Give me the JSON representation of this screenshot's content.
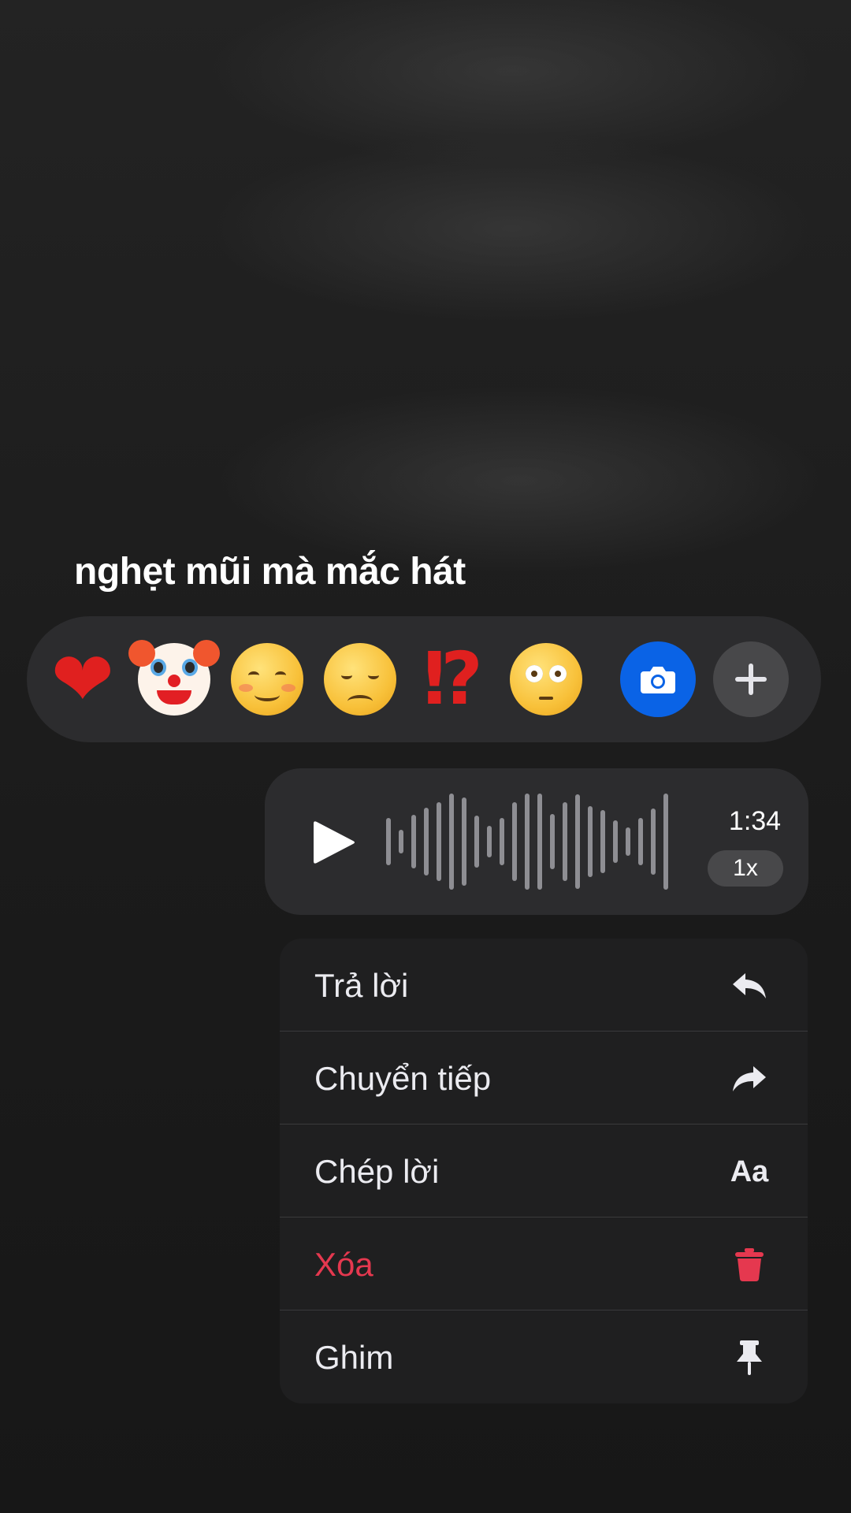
{
  "message": {
    "caption": "nghẹt mũi mà mắc hát"
  },
  "reactions": [
    {
      "name": "heart-emoji",
      "glyph": "❤"
    },
    {
      "name": "clown-face-emoji",
      "glyph": ""
    },
    {
      "name": "smiling-face-emoji",
      "glyph": ""
    },
    {
      "name": "disappointed-face-emoji",
      "glyph": ""
    },
    {
      "name": "exclamation-question-emoji",
      "glyph": "⁉"
    },
    {
      "name": "flushed-face-emoji",
      "glyph": ""
    }
  ],
  "reaction_actions": {
    "camera_icon": "camera-icon",
    "plus_icon": "plus-icon"
  },
  "voice_message": {
    "duration": "1:34",
    "speed": "1x",
    "play_icon": "play-icon"
  },
  "menu": {
    "items": [
      {
        "label": "Trả lời",
        "icon": "reply-icon"
      },
      {
        "label": "Chuyển tiếp",
        "icon": "forward-icon"
      },
      {
        "label": "Chép lời",
        "icon_text": "Aa"
      },
      {
        "label": "Xóa",
        "icon": "trash-icon",
        "color": "#e5384f"
      },
      {
        "label": "Ghim",
        "icon": "pin-icon"
      }
    ]
  },
  "colors": {
    "background": "#1b1b1b",
    "bubble": "#2c2c2e",
    "camera_accent": "#0a63e6",
    "danger": "#e5384f"
  }
}
